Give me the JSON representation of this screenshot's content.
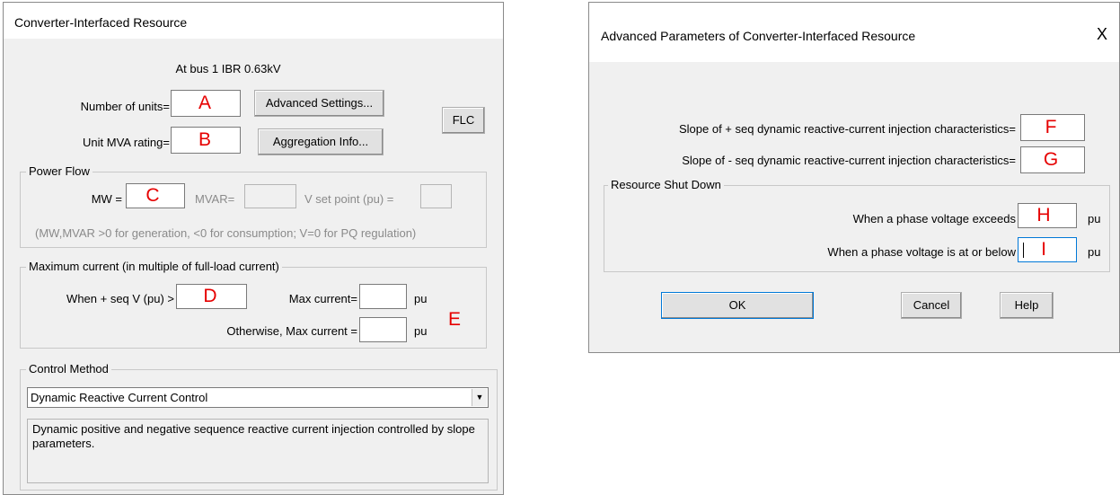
{
  "main_dialog": {
    "title": "Converter-Interfaced Resource",
    "bus_info": "At bus 1 IBR 0.63kV",
    "num_units_label": "Number of units=",
    "num_units_marker": "A",
    "unit_mva_label": "Unit MVA rating=",
    "unit_mva_marker": "B",
    "advanced_settings_button": "Advanced Settings...",
    "aggregation_info_button": "Aggregation Info...",
    "flc_button": "FLC",
    "power_flow": {
      "group_title": "Power Flow",
      "mw_label": "MW =",
      "mw_marker": "C",
      "mvar_label": "MVAR=",
      "vset_label": "V set point (pu) =",
      "note": "(MW,MVAR >0 for generation,  <0 for consumption; V=0 for PQ regulation)"
    },
    "max_current": {
      "group_title": "Maximum current (in multiple of full-load current)",
      "when_label": "When + seq V (pu) >",
      "when_marker": "D",
      "max_current_label": "Max current=",
      "pu_1": "pu",
      "otherwise_label": "Otherwise, Max current =",
      "pu_2": "pu",
      "marker_e": "E"
    },
    "control_method": {
      "group_title": "Control Method",
      "selected": "Dynamic Reactive Current Control",
      "description": "Dynamic positive and negative sequence reactive current injection controlled by slope parameters."
    }
  },
  "advanced_dialog": {
    "title": "Advanced Parameters of Converter-Interfaced Resource",
    "close_glyph": "X",
    "pos_slope_label": "Slope of + seq dynamic reactive-current injection characteristics=",
    "pos_slope_marker": "F",
    "neg_slope_label": "Slope of - seq dynamic reactive-current injection characteristics=",
    "neg_slope_marker": "G",
    "shutdown": {
      "group_title": "Resource Shut Down",
      "exceeds_label": "When a phase voltage exceeds",
      "exceeds_marker": "H",
      "exceeds_unit": "pu",
      "below_label": "When a phase voltage is at or below",
      "below_marker": "I",
      "below_unit": "pu"
    },
    "ok_button": "OK",
    "cancel_button": "Cancel",
    "help_button": "Help"
  }
}
